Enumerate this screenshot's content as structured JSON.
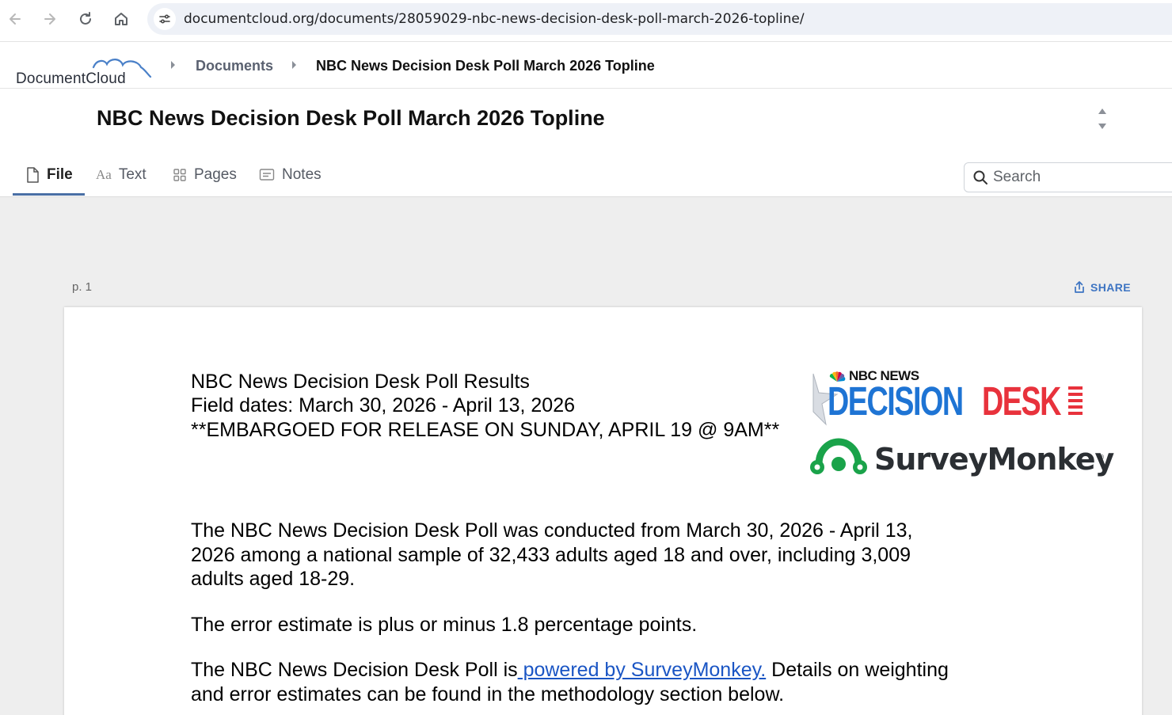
{
  "browser": {
    "url": "documentcloud.org/documents/28059029-nbc-news-decision-desk-poll-march-2026-topline/"
  },
  "app": {
    "logo_text": "DocumentCloud",
    "breadcrumb": {
      "documents_label": "Documents",
      "current_label": "NBC News Decision Desk Poll March 2026 Topline"
    }
  },
  "document": {
    "title": "NBC News Decision Desk Poll March 2026 Topline"
  },
  "tabs": [
    {
      "label": "File",
      "icon": "file-icon",
      "active": true
    },
    {
      "label": "Text",
      "icon": "text-aa-icon",
      "active": false
    },
    {
      "label": "Pages",
      "icon": "grid-icon",
      "active": false
    },
    {
      "label": "Notes",
      "icon": "notes-icon",
      "active": false
    }
  ],
  "search": {
    "placeholder": "Search"
  },
  "viewer": {
    "page_label": "p. 1",
    "share_label": "SHARE"
  },
  "page1": {
    "header_line1": "NBC News Decision Desk Poll Results",
    "header_line2": "Field dates: March 30, 2026 - April 13, 2026",
    "header_line3": "**EMBARGOED FOR RELEASE ON SUNDAY, APRIL 19 @ 9AM**",
    "logo_nbc_news": "NBC NEWS",
    "logo_decision": "DECISION",
    "logo_desk": "DESK",
    "logo_surveymonkey": "SurveyMonkey",
    "para1_line1": "The NBC News Decision Desk Poll was conducted from March 30, 2026 - April 13,",
    "para1_line2": "2026 among a national sample of 32,433 adults aged 18 and over, including 3,009",
    "para1_line3": "adults aged 18-29.",
    "para2": "The error estimate is plus or minus 1.8 percentage points.",
    "para3_before": "The NBC News Decision Desk Poll is",
    "para3_link": " powered by SurveyMonkey.",
    "para3_after": " Details on weighting",
    "para3_line2": "and error estimates can be found in the methodology section below."
  },
  "colors": {
    "accent_blue": "#3d74c2",
    "tab_underline": "#4a6fa5",
    "decision_blue": "#1e74d4",
    "desk_red": "#e8323c",
    "surveymonkey_green": "#1aa34a"
  }
}
